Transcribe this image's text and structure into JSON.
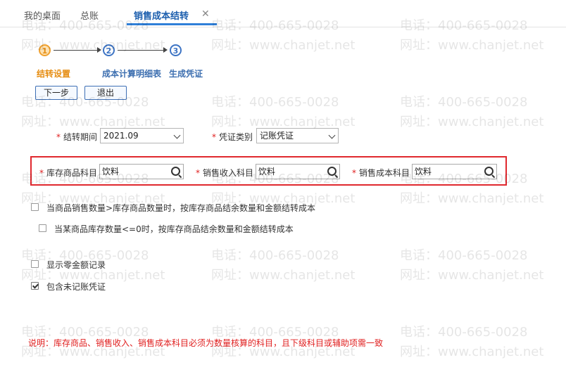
{
  "tabs": [
    {
      "label": "我的桌面"
    },
    {
      "label": "总账"
    },
    {
      "label": "销售成本结转",
      "active": true
    }
  ],
  "steps": [
    {
      "number": "1",
      "label": "结转设置",
      "state": "active"
    },
    {
      "number": "2",
      "label": "成本计算明细表",
      "state": "idle"
    },
    {
      "number": "3",
      "label": "生成凭证",
      "state": "idle"
    }
  ],
  "buttons": {
    "next": "下一步",
    "exit": "退出"
  },
  "form": {
    "period_label": "结转期间",
    "period_value": "2021.09",
    "voucher_label": "凭证类别",
    "voucher_value": "记账凭证",
    "inventory_label": "库存商品科目",
    "inventory_value": "饮料",
    "revenue_label": "销售收入科目",
    "revenue_value": "饮料",
    "cost_label": "销售成本科目",
    "cost_value": "饮料"
  },
  "options": [
    {
      "label": "当商品销售数量>库存商品数量时，按库存商品结余数量和金额结转成本",
      "checked": false
    },
    {
      "label": "当某商品库存数量<=0时，按库存商品结余数量和金额结转成本",
      "checked": false
    },
    {
      "label": "显示零金额记录",
      "checked": false
    },
    {
      "label": "包含未记账凭证",
      "checked": true
    }
  ],
  "note": "说明：库存商品、销售收入、销售成本科目必须为数量核算的科目，且下级科目或辅助项需一致",
  "watermark": {
    "phone": "电话：400-665-0028",
    "site": "网址：www.chanjet.net"
  },
  "colors": {
    "accent": "#2f7fd8",
    "step_active": "#f0a12f",
    "required": "#e02020",
    "highlight_box": "#e0282e"
  }
}
